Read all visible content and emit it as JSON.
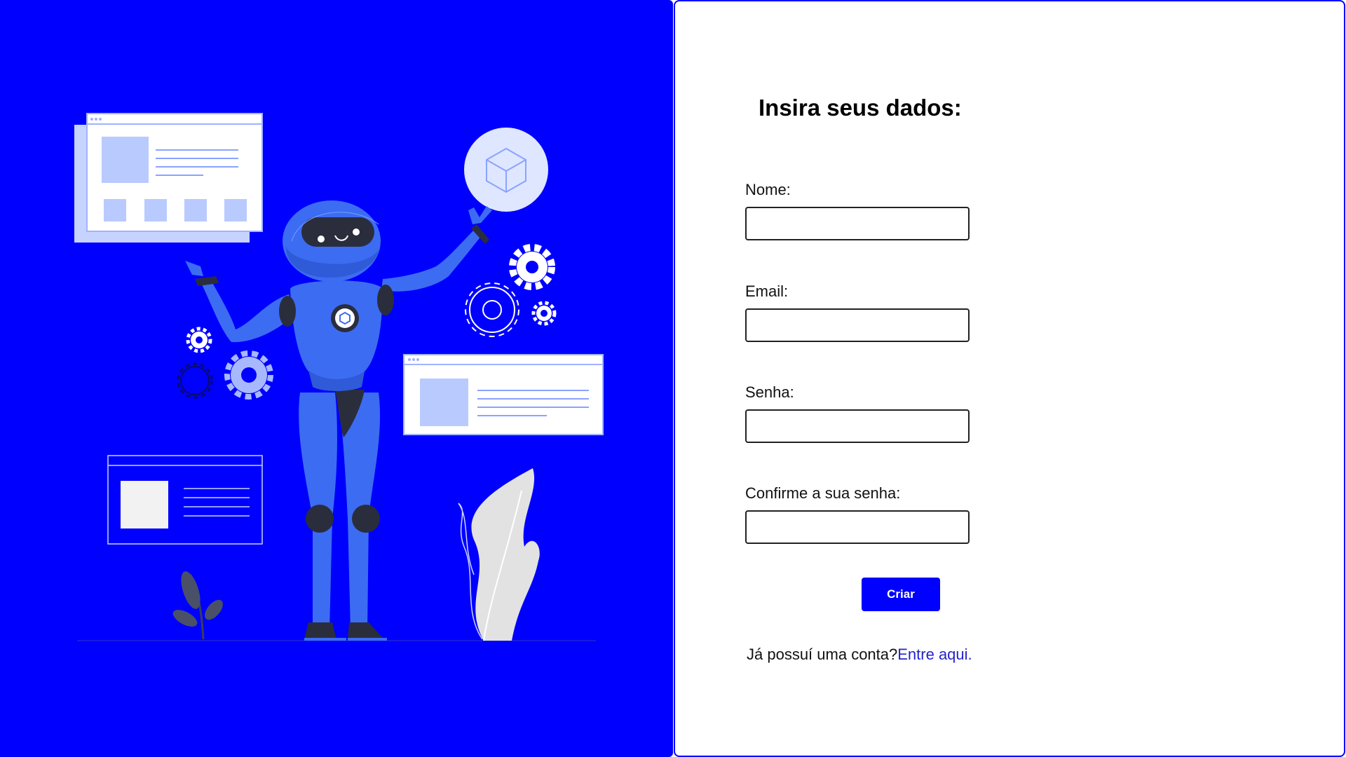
{
  "theme": {
    "accent": "#0000ff",
    "link": "#2424c8"
  },
  "illustration": {
    "subject": "robot-with-gears-and-windows"
  },
  "form": {
    "title": "Insira seus dados:",
    "fields": [
      {
        "label": "Nome:",
        "value": "",
        "type": "text"
      },
      {
        "label": "Email:",
        "value": "",
        "type": "email"
      },
      {
        "label": "Senha:",
        "value": "",
        "type": "password"
      },
      {
        "label": "Confirme a sua senha:",
        "value": "",
        "type": "password"
      }
    ],
    "submit_label": "Criar",
    "login_prompt": "Já possuí uma conta?",
    "login_link": "Entre aqui."
  }
}
